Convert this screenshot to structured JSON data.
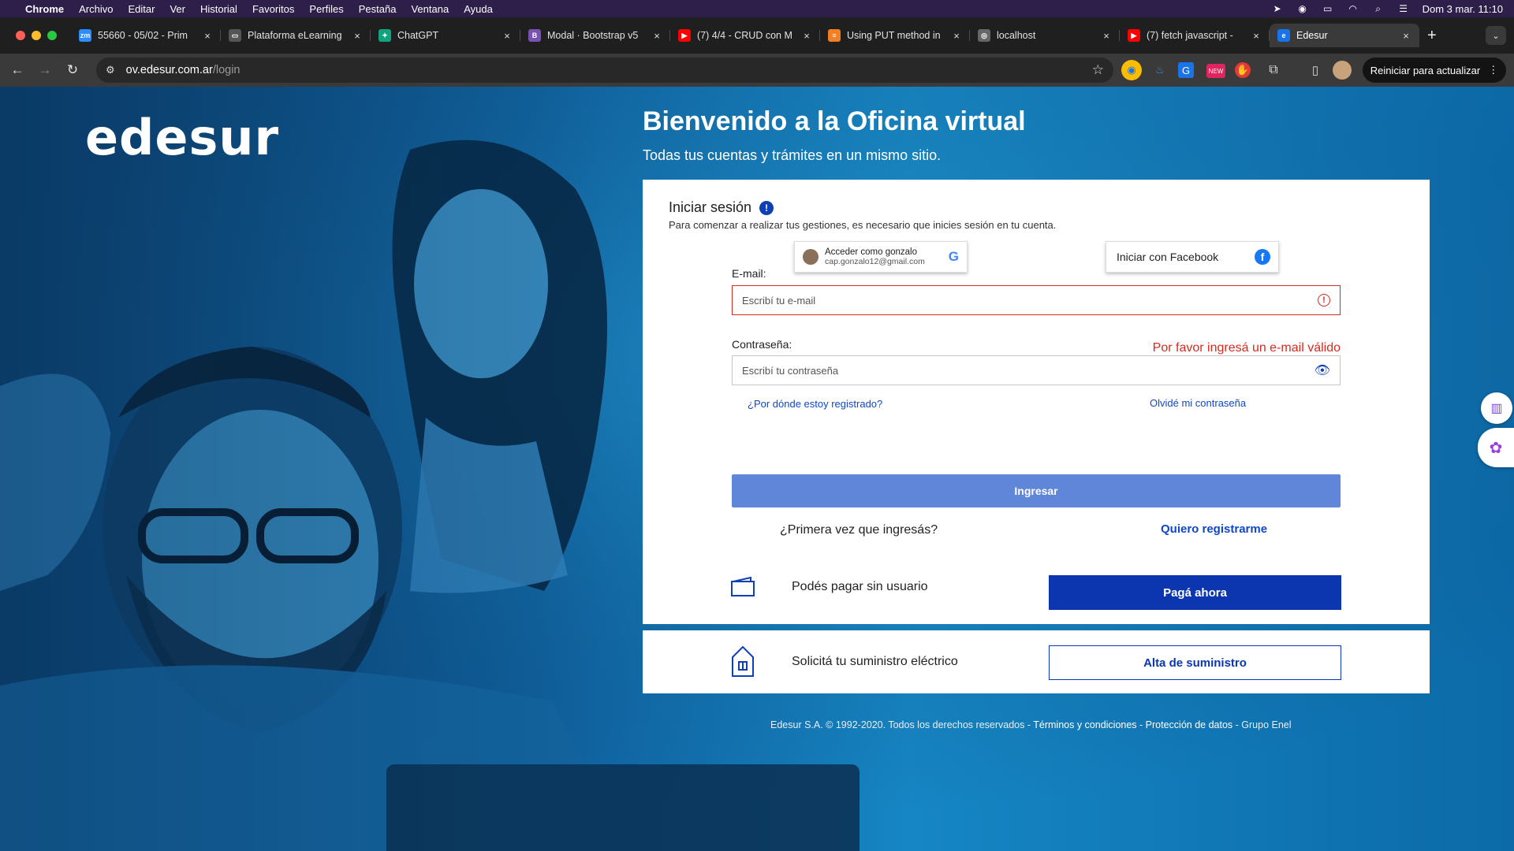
{
  "menubar": {
    "app": "Chrome",
    "items": [
      "Archivo",
      "Editar",
      "Ver",
      "Historial",
      "Favoritos",
      "Perfiles",
      "Pestaña",
      "Ventana",
      "Ayuda"
    ],
    "datetime": "Dom 3 mar.  11:10"
  },
  "tabs": [
    {
      "title": "55660 - 05/02 - Prim",
      "favicon": "zoom-icon",
      "color": "#2d8cff",
      "glyph": "zm"
    },
    {
      "title": "Plataforma eLearning",
      "favicon": "elearning-icon",
      "color": "#555555",
      "glyph": "▭"
    },
    {
      "title": "ChatGPT",
      "favicon": "chatgpt-icon",
      "color": "#10a37f",
      "glyph": "✦"
    },
    {
      "title": "Modal · Bootstrap v5",
      "favicon": "bootstrap-icon",
      "color": "#7952b3",
      "glyph": "B"
    },
    {
      "title": "(7) 4/4 - CRUD con M",
      "favicon": "youtube-icon",
      "color": "#ff0000",
      "glyph": "▶"
    },
    {
      "title": "Using PUT method in",
      "favicon": "stackoverflow-icon",
      "color": "#f48024",
      "glyph": "≡"
    },
    {
      "title": "localhost",
      "favicon": "globe-icon",
      "color": "#666666",
      "glyph": "◎"
    },
    {
      "title": "(7) fetch javascript -",
      "favicon": "youtube-icon",
      "color": "#ff0000",
      "glyph": "▶"
    },
    {
      "title": "Edesur",
      "favicon": "edesur-icon",
      "color": "#1a73e8",
      "glyph": "e"
    }
  ],
  "toolbar": {
    "url_host": "ov.edesur.com.ar",
    "url_path": "/login",
    "update_label": "Reiniciar para actualizar"
  },
  "page": {
    "logo": "edesur",
    "welcome_title": "Bienvenido a la Oficina virtual",
    "welcome_subtitle": "Todas tus cuentas y trámites en un mismo sitio.",
    "login": {
      "title": "Iniciar sesión",
      "description": "Para comenzar a realizar tus gestiones, es necesario que inicies sesión en tu cuenta.",
      "google_name": "Acceder como gonzalo",
      "google_email": "cap.gonzalo12@gmail.com",
      "facebook_label": "Iniciar con Facebook",
      "email_label": "E-mail:",
      "email_placeholder": "Escribí tu e-mail",
      "email_value": "",
      "email_error": "Por favor ingresá un e-mail válido",
      "password_label": "Contraseña:",
      "password_placeholder": "Escribí tu contraseña",
      "where_registered": "¿Por dónde estoy registrado?",
      "forgot_password": "Olvidé mi contraseña",
      "submit": "Ingresar",
      "first_time": "¿Primera vez que ingresás?",
      "register": "Quiero registrarme"
    },
    "pay": {
      "text": "Podés pagar sin usuario",
      "button": "Pagá ahora"
    },
    "supply": {
      "text": "Solicitá tu suministro eléctrico",
      "button": "Alta de suministro"
    },
    "footer": {
      "copyright": "Edesur S.A. © 1992-2020. Todos los derechos reservados - ",
      "terms": "Términos y condiciones",
      "sep1": " - ",
      "privacy": "Protección de datos",
      "sep2": " - ",
      "group": "Grupo Enel"
    }
  },
  "colors": {
    "brand_blue": "#0b36b0",
    "error_red": "#d52b1e",
    "submit_disabled": "#5f86d8"
  }
}
